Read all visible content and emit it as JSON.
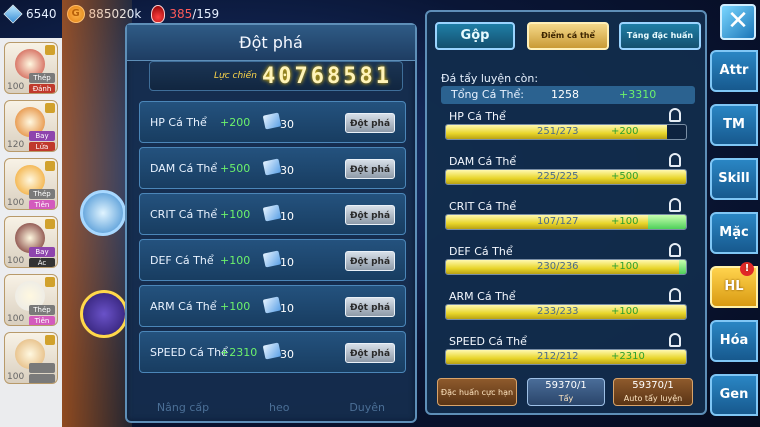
{
  "currencies": {
    "gems": "6540",
    "gold": "885020k",
    "stamina_current": "385",
    "stamina_max": "/159"
  },
  "heroes": [
    {
      "level": "100",
      "tag1": "Thép",
      "tag2": "Đánh",
      "tag1_color": "#7a7a7a",
      "tag2_color": "#c0392b",
      "face_color": "#c9453a"
    },
    {
      "level": "120",
      "tag1": "Bay",
      "tag2": "Lửa",
      "tag1_color": "#8e44ad",
      "tag2_color": "#c0392b",
      "face_color": "#e07a1f"
    },
    {
      "level": "100",
      "tag1": "Thép",
      "tag2": "Tiên",
      "tag1_color": "#7a7a7a",
      "tag2_color": "#d35bbd",
      "face_color": "#f0a020"
    },
    {
      "level": "100",
      "tag1": "Bay",
      "tag2": "Ác",
      "tag1_color": "#8e44ad",
      "tag2_color": "#333333",
      "face_color": "#6a1f1f"
    },
    {
      "level": "100",
      "tag1": "Thép",
      "tag2": "Tiên",
      "tag1_color": "#7a7a7a",
      "tag2_color": "#d35bbd",
      "face_color": "#e8e8e8"
    },
    {
      "level": "100",
      "tag1": "",
      "tag2": "",
      "tag1_color": "#7a7a7a",
      "tag2_color": "#7a7a7a",
      "face_color": "#e0b070"
    }
  ],
  "breakthrough_panel": {
    "title": "Đột phá",
    "power_label": "Lực chiến",
    "power_value": "40768581",
    "rows": [
      {
        "name": "HP Cá Thể",
        "bonus": "+200",
        "cost": "30",
        "button": "Đột phá"
      },
      {
        "name": "DAM Cá Thể",
        "bonus": "+500",
        "cost": "30",
        "button": "Đột phá"
      },
      {
        "name": "CRIT Cá Thể",
        "bonus": "+100",
        "cost": "10",
        "button": "Đột phá"
      },
      {
        "name": "DEF Cá Thể",
        "bonus": "+100",
        "cost": "10",
        "button": "Đột phá"
      },
      {
        "name": "ARM Cá Thể",
        "bonus": "+100",
        "cost": "10",
        "button": "Đột phá"
      },
      {
        "name": "SPEED Cá Thể",
        "bonus": "+2310",
        "cost": "30",
        "button": "Đột phá"
      }
    ],
    "footer": [
      "Nâng cấp",
      "heo",
      "Duyên"
    ]
  },
  "training_panel": {
    "tabs": [
      "Gộp",
      "Điểm cá thể",
      "Tăng đặc huấn"
    ],
    "active_tab": "Điểm cá thể",
    "remaining_label": "Đá tẩy luyện còn:",
    "total_label": "Tổng Cá Thể:",
    "total_value": "1258",
    "total_bonus": "+3310",
    "stats": [
      {
        "name": "HP Cá Thể",
        "value": "251/273",
        "bonus": "+200",
        "fill": 0.92,
        "ext": 0.0
      },
      {
        "name": "DAM Cá Thể",
        "value": "225/225",
        "bonus": "+500",
        "fill": 1.0,
        "ext": 0.0
      },
      {
        "name": "CRIT Cá Thể",
        "value": "107/127",
        "bonus": "+100",
        "fill": 0.84,
        "ext": 0.16
      },
      {
        "name": "DEF Cá Thể",
        "value": "230/236",
        "bonus": "+100",
        "fill": 0.97,
        "ext": 0.03
      },
      {
        "name": "ARM Cá Thể",
        "value": "233/233",
        "bonus": "+100",
        "fill": 1.0,
        "ext": 0.0
      },
      {
        "name": "SPEED Cá Thể",
        "value": "212/212",
        "bonus": "+2310",
        "fill": 1.0,
        "ext": 0.0
      }
    ],
    "buttons": {
      "special": "Đặc huấn cực hạn",
      "wash_count": "59370/1",
      "wash_label": "Tẩy",
      "auto_count": "59370/1",
      "auto_label": "Auto tẩy luyện"
    }
  },
  "side_tabs": {
    "close": "✕",
    "items": [
      "Attr",
      "TM",
      "Skill",
      "Mặc",
      "HL",
      "Hóa",
      "Gen"
    ],
    "active": "HL",
    "badge": "!"
  }
}
